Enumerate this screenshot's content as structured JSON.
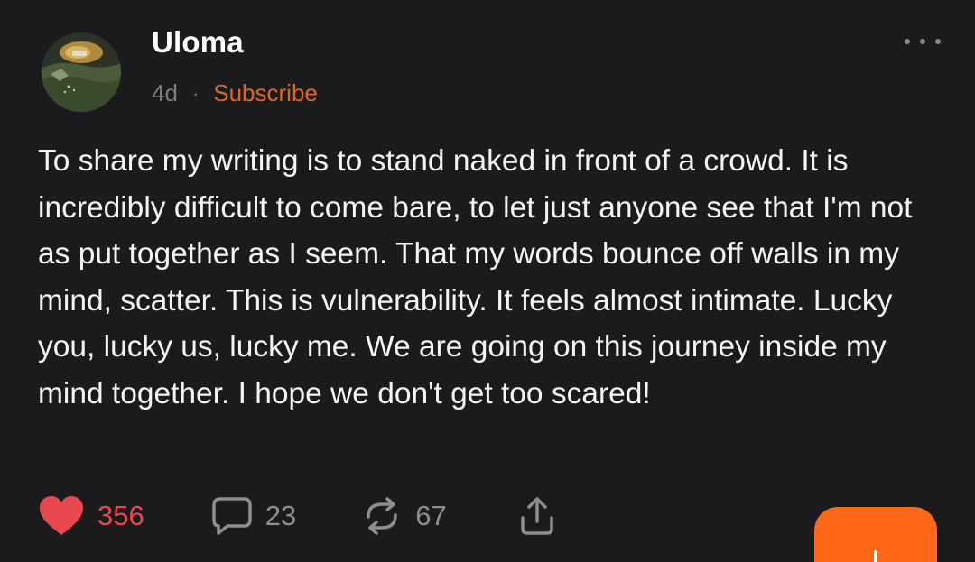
{
  "author": {
    "name": "Uloma",
    "avatar_icon": "landscape-avatar"
  },
  "meta": {
    "timestamp": "4d",
    "separator": "·",
    "subscribe_label": "Subscribe"
  },
  "menu": {
    "icon": "more-horizontal-icon"
  },
  "body": "To share my writing is to stand naked in front of a crowd. It is incredibly difficult to come bare, to let just anyone see that I'm not as put together as I seem. That my words bounce off walls in my mind, scatter. This is vulnerability. It feels almost intimate. Lucky you, lucky us, lucky me. We are going on this journey inside my mind together. I hope we don't get too scared!",
  "actions": {
    "likes": {
      "icon": "heart-icon",
      "count": "356",
      "color": "#e8474d"
    },
    "comments": {
      "icon": "comment-icon",
      "count": "23"
    },
    "restacks": {
      "icon": "restack-icon",
      "count": "67"
    },
    "share": {
      "icon": "share-icon"
    }
  },
  "fab": {
    "icon": "plus-icon",
    "color": "#ff6719"
  },
  "colors": {
    "background": "#1b1a1c",
    "accent": "#e0651f",
    "muted": "#7e7c80"
  }
}
